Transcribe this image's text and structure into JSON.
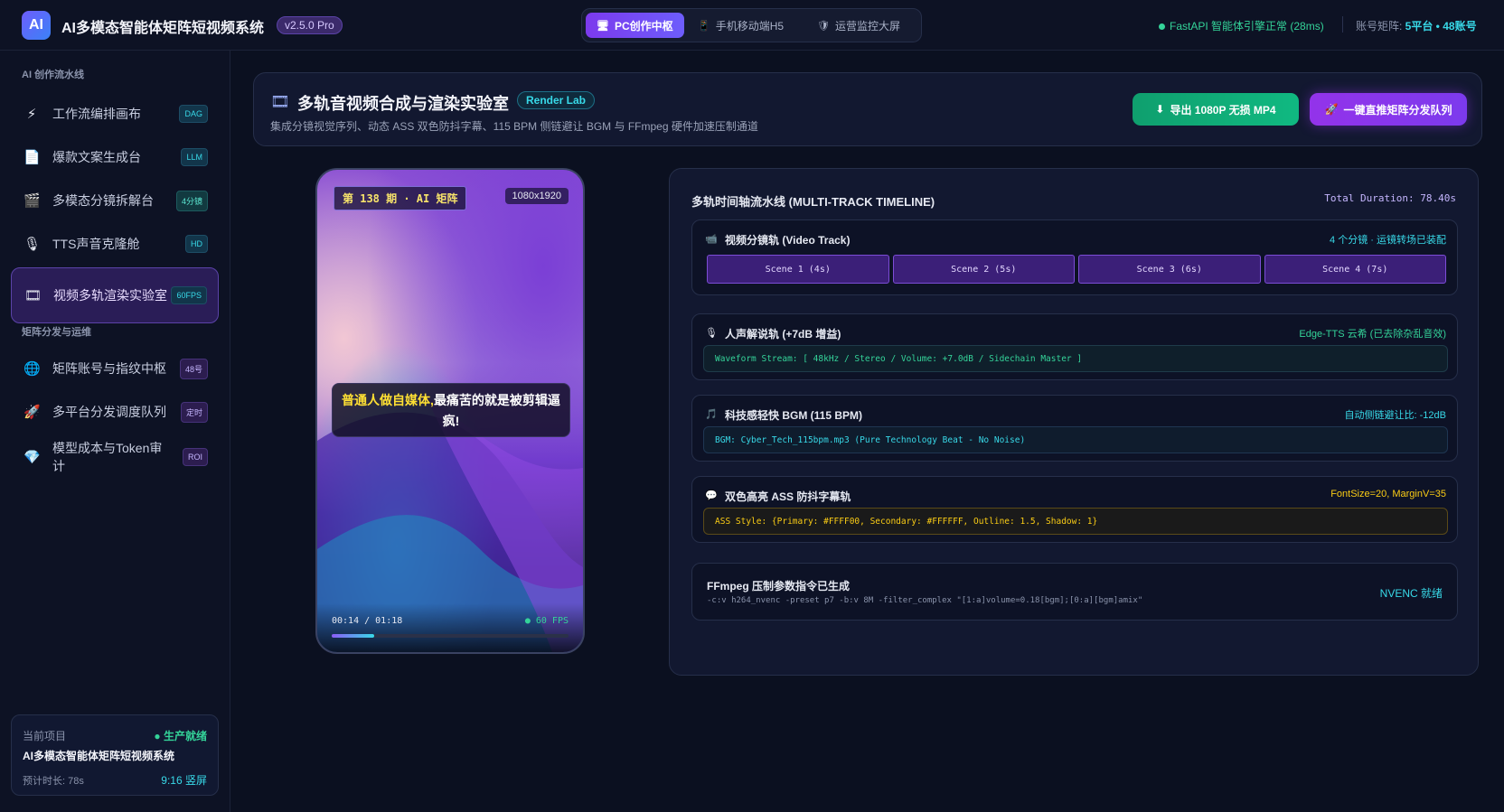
{
  "header": {
    "logo": "AI",
    "title": "AI多模态智能体矩阵短视频系统",
    "version": "v2.5.0 Pro",
    "mode_tabs": [
      {
        "icon": "🖥",
        "label": "PC创作中枢",
        "active": true
      },
      {
        "icon": "📱",
        "label": "手机移动端H5",
        "active": false
      },
      {
        "icon": "🛡",
        "label": "运营监控大屏",
        "active": false
      }
    ],
    "engine_status": "FastAPI 智能体引擎正常 (28ms)",
    "account_label": "账号矩阵: ",
    "account_value": "5平台 • 48账号"
  },
  "sidebar": {
    "section1": "AI 创作流水线",
    "section2": "矩阵分发与运维",
    "items": [
      {
        "icon": "⚡",
        "label": "工作流编排画布",
        "badge": "DAG"
      },
      {
        "icon": "📄",
        "label": "爆款文案生成台",
        "badge": "LLM"
      },
      {
        "icon": "🎬",
        "label": "多模态分镜拆解台",
        "badge": "4分镜"
      },
      {
        "icon": "🎙",
        "label": "TTS声音克隆舱",
        "badge": "HD"
      },
      {
        "icon": "🎞",
        "label": "视频多轨渲染实验室",
        "badge": "60FPS"
      },
      {
        "icon": "🌐",
        "label": "矩阵账号与指纹中枢",
        "badge": "48号"
      },
      {
        "icon": "🚀",
        "label": "多平台分发调度队列",
        "badge": "定时"
      },
      {
        "icon": "💎",
        "label": "模型成本与Token审计",
        "badge": "ROI"
      }
    ],
    "project": {
      "label": "当前项目",
      "status": "● 生产就绪",
      "name": "AI多模态智能体矩阵短视频系统",
      "duration": "预计时长: 78s",
      "ratio": "9:16 竖屏"
    }
  },
  "main": {
    "icon": "🎞",
    "title": "多轨音视频合成与渲染实验室",
    "tag": "Render Lab",
    "subtitle": "集成分镜视觉序列、动态 ASS 双色防抖字幕、115 BPM 侧链避让 BGM 与 FFmpeg 硬件加速压制通道",
    "export_button": "导出 1080P 无损 MP4",
    "export_icon": "⬇",
    "dispatch_button": "一键直推矩阵分发队列",
    "dispatch_icon": "🚀"
  },
  "preview": {
    "episode": "第 138 期 · AI 矩阵",
    "resolution": "1080x1920",
    "subtitle_highlight": "普通人做自媒体,",
    "subtitle_rest": "最痛苦的就是被剪辑逼疯!",
    "time": "00:14 / 01:18",
    "fps": "● 60 FPS",
    "progress": 0.18
  },
  "timeline": {
    "title": "多轨时间轴流水线 (MULTI-TRACK TIMELINE)",
    "total": "Total Duration: 78.40s",
    "video_track": {
      "icon": "📹",
      "name": "视频分镜轨 (Video Track)",
      "meta": "4 个分镜 · 运镜转场已装配",
      "scenes": [
        "Scene 1 (4s)",
        "Scene 2 (5s)",
        "Scene 3 (6s)",
        "Scene 4 (7s)"
      ]
    },
    "voice_track": {
      "icon": "🎙",
      "name": "人声解说轨 (+7dB 增益)",
      "meta": "Edge-TTS 云希 (已去除杂乱音效)",
      "code": "Waveform Stream: [ 48kHz / Stereo / Volume: +7.0dB / Sidechain Master ]"
    },
    "bgm_track": {
      "icon": "🎵",
      "name": "科技感轻快 BGM (115 BPM)",
      "meta": "自动侧链避让比: -12dB",
      "code": "BGM: Cyber_Tech_115bpm.mp3 (Pure Technology Beat - No Noise)"
    },
    "sub_track": {
      "icon": "💬",
      "name": "双色高亮 ASS 防抖字幕轨",
      "meta": "FontSize=20, MarginV=35",
      "code": "ASS Style: {Primary: #FFFF00, Secondary: #FFFFFF, Outline: 1.5, Shadow: 1}"
    },
    "ffmpeg": {
      "title": "FFmpeg 压制参数指令已生成",
      "cmd": "-c:v h264_nvenc -preset p7 -b:v 8M -filter_complex \"[1:a]volume=0.18[bgm];[0:a][bgm]amix\"",
      "status": "NVENC 就绪"
    }
  }
}
